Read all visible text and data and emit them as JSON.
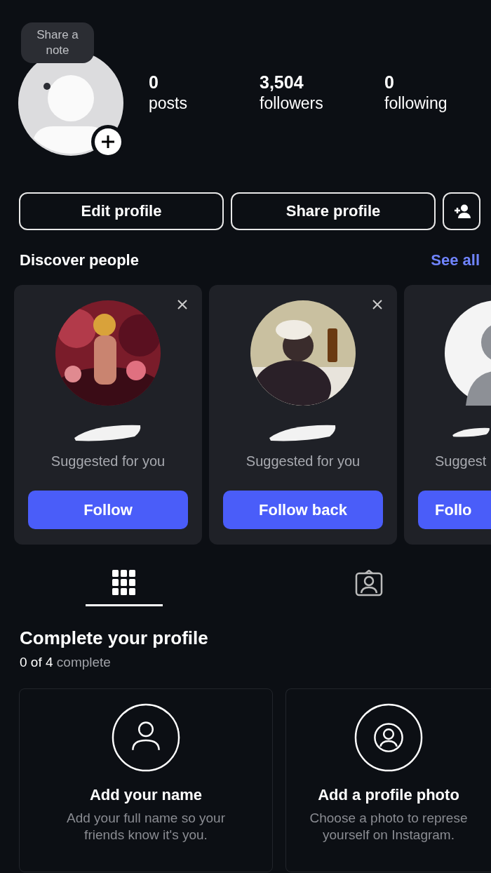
{
  "profile": {
    "note_bubble": "Share a note",
    "stats": [
      {
        "value": "0",
        "label": "posts"
      },
      {
        "value": "3,504",
        "label": "followers"
      },
      {
        "value": "0",
        "label": "following"
      }
    ]
  },
  "actions": [
    "Edit profile",
    "Share profile"
  ],
  "discover": {
    "title": "Discover people",
    "link": "See all",
    "cards": [
      {
        "kind": "full",
        "name_hidden": true,
        "subtitle": "Suggested for you",
        "button": "Follow"
      },
      {
        "kind": "full",
        "name_hidden": true,
        "subtitle": "Suggested for you",
        "button": "Follow back"
      },
      {
        "kind": "partial",
        "name_hidden": true,
        "subtitle": "Suggest",
        "button": "Follo"
      }
    ]
  },
  "tabs": [
    {
      "kind": "grid",
      "selected": true
    },
    {
      "kind": "tagged",
      "selected": false
    }
  ],
  "complete": {
    "title": "Complete your profile",
    "progress": "**0 of 4** complete",
    "cards": [
      {
        "kind": "full",
        "title": "Add your name",
        "description": "Add your full name so your\nfriends know it's you."
      },
      {
        "kind": "partial",
        "title": "Add a profile photo",
        "description": "Choose a photo to represe\nyourself on Instagram."
      }
    ]
  }
}
